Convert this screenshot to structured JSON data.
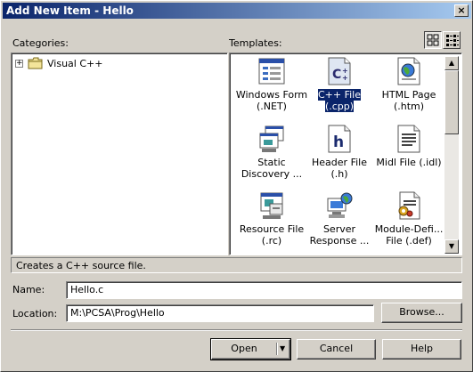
{
  "window": {
    "title": "Add New Item - Hello",
    "close_glyph": "×"
  },
  "categories": {
    "label": "Categories:",
    "items": [
      {
        "label": "Visual C++",
        "expander": "+",
        "icon": "folder-icon"
      }
    ]
  },
  "templates": {
    "label": "Templates:",
    "view_buttons": [
      {
        "name": "large-icons-view",
        "pressed": true
      },
      {
        "name": "small-icons-view",
        "pressed": false
      }
    ],
    "items": [
      {
        "label": "Windows Form\n(.NET)",
        "icon": "windows-form-icon",
        "selected": false
      },
      {
        "label": "C++ File (.cpp)",
        "icon": "cpp-file-icon",
        "selected": true
      },
      {
        "label": "HTML Page\n(.htm)",
        "icon": "html-page-icon",
        "selected": false
      },
      {
        "label": "Static\nDiscovery ...",
        "icon": "static-discovery-icon",
        "selected": false
      },
      {
        "label": "Header File (.h)",
        "icon": "header-file-icon",
        "selected": false
      },
      {
        "label": "Midl File (.idl)",
        "icon": "midl-file-icon",
        "selected": false
      },
      {
        "label": "Resource File\n(.rc)",
        "icon": "resource-file-icon",
        "selected": false
      },
      {
        "label": "Server\nResponse ...",
        "icon": "server-response-icon",
        "selected": false
      },
      {
        "label": "Module-Defi...\nFile (.def)",
        "icon": "module-def-icon",
        "selected": false
      }
    ]
  },
  "description": "Creates a C++ source file.",
  "name_field": {
    "label": "Name:",
    "value": "Hello.c"
  },
  "location_field": {
    "label": "Location:",
    "value": "M:\\PCSA\\Prog\\Hello"
  },
  "buttons": {
    "browse": "Browse...",
    "open": "Open",
    "cancel": "Cancel",
    "help": "Help"
  },
  "colors": {
    "face": "#d4d0c8",
    "title_start": "#0a246a",
    "title_end": "#a6caf0",
    "selection": "#0a246a"
  }
}
